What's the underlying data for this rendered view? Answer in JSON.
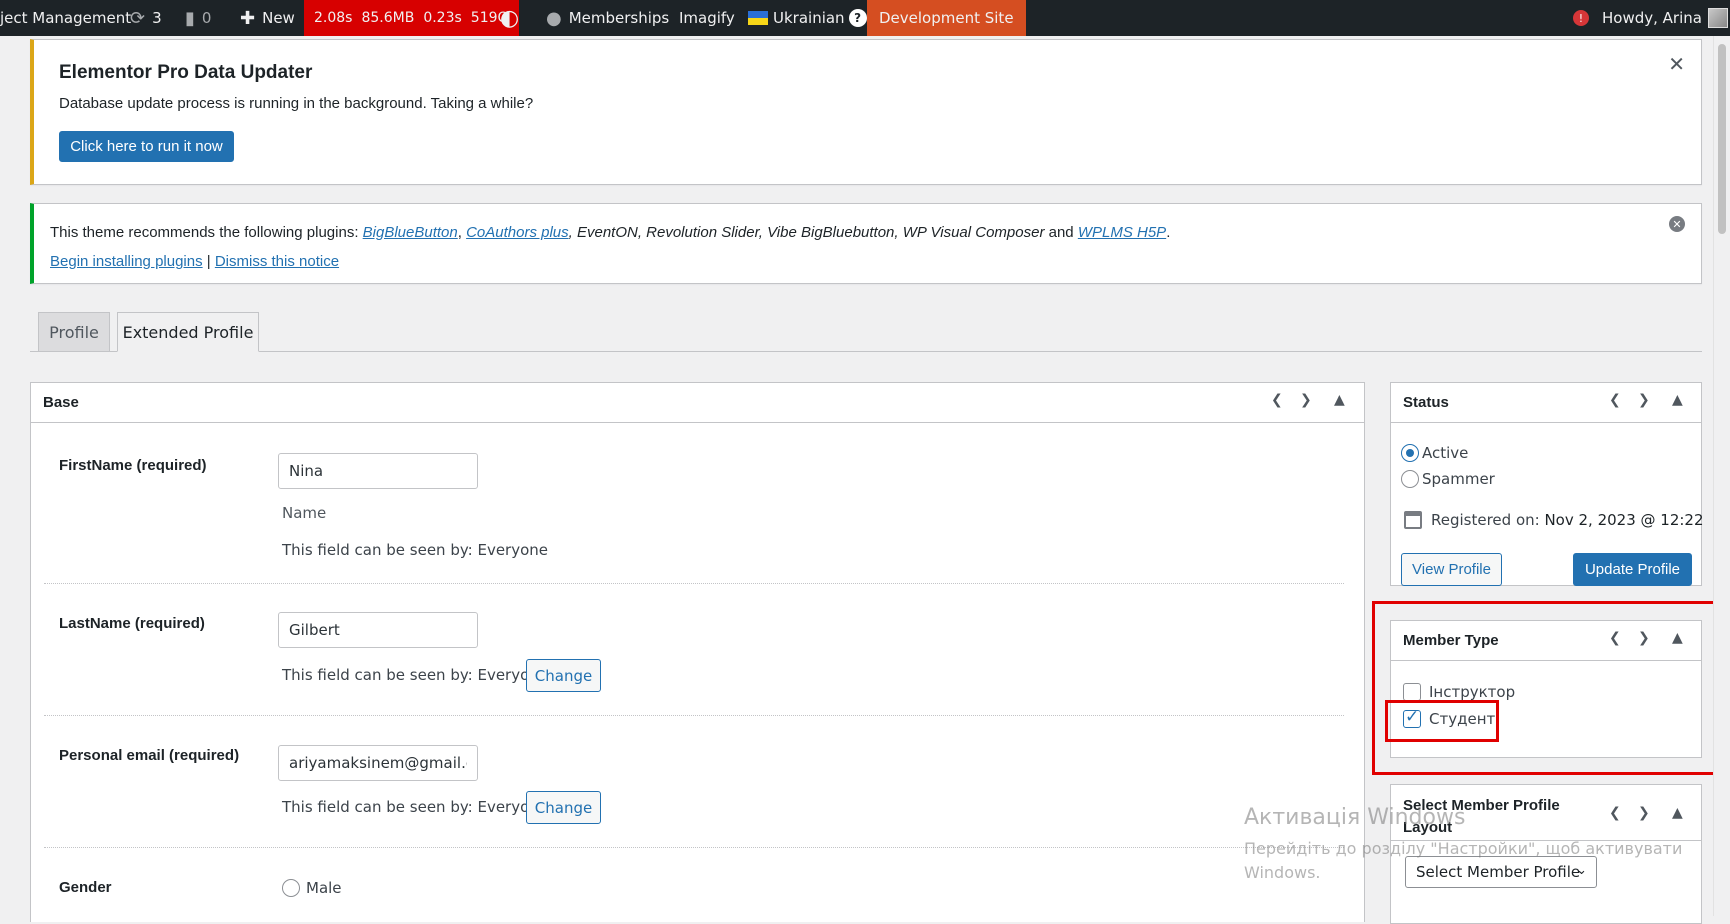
{
  "adminbar": {
    "site_name": "ject Management",
    "updates_count": "3",
    "comments_count": "0",
    "new_label": "New",
    "perf": [
      "2.08s",
      "85.6MB",
      "0.23s",
      "519Q"
    ],
    "memberships": "Memberships",
    "imagify": "Imagify",
    "language": "Ukrainian",
    "dev_site": "Development Site",
    "notification_badge": "!",
    "howdy": "Howdy, Arina"
  },
  "elementor_notice": {
    "title": "Elementor Pro Data Updater",
    "desc": "Database update process is running in the background. Taking a while?",
    "button": "Click here to run it now"
  },
  "theme_notice": {
    "prefix": "This theme recommends the following plugins: ",
    "plugin1": "BigBlueButton",
    "sep1": ", ",
    "plugin2": "CoAuthors plus",
    "middle": ", EventON, Revolution Slider, Vibe BigBluebutton, WP Visual Composer",
    "and": " and ",
    "plugin3": "WPLMS H5P",
    "end": ".",
    "install_link": "Begin installing plugins",
    "divider": " | ",
    "dismiss_link": "Dismiss this notice"
  },
  "tabs": {
    "profile": "Profile",
    "extended": "Extended Profile"
  },
  "base": {
    "title": "Base",
    "firstname_label": "FirstName (required)",
    "firstname_value": "Nina",
    "firstname_hint": "Name",
    "visibility_text": "This field can be seen by: Everyone",
    "lastname_label": "LastName (required)",
    "lastname_value": "Gilbert",
    "email_label": "Personal email (required)",
    "email_value": "ariyamaksinem@gmail.com",
    "change_label": "Change",
    "gender_label": "Gender",
    "gender_option": "Male"
  },
  "status": {
    "title": "Status",
    "option_active": "Active",
    "option_spammer": "Spammer",
    "registered_prefix": "Registered on: ",
    "registered_date": "Nov 2, 2023 @ 12:22",
    "view_profile": "View Profile",
    "update_profile": "Update Profile"
  },
  "member_type": {
    "title": "Member Type",
    "option1": "Інструктор",
    "option2": "Студент"
  },
  "layout_box": {
    "title_line1": "Select Member Profile",
    "title_line2": "Layout",
    "select_value": "Select Member Profile"
  },
  "watermark": {
    "line1": "Активація Windows",
    "line2": "Перейдіть до розділу \"Настройки\", щоб активувати",
    "line3": "Windows."
  }
}
